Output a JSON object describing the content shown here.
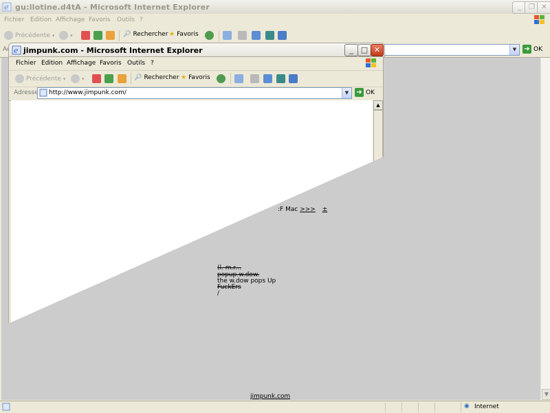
{
  "outer": {
    "title": "gu:llotine.d4tA - Microsoft Internet Explorer",
    "menu": [
      "Fichier",
      "Edition",
      "Affichage",
      "Favoris",
      "Outils",
      "?"
    ],
    "toolbar": {
      "back": "Précédente",
      "search": "Rechercher",
      "favorites": "Favoris"
    },
    "address_label": "Ac",
    "go_label": "OK",
    "status_zone": "Internet"
  },
  "inner": {
    "title": "jimpunk.com - Microsoft Internet Explorer",
    "menu": [
      "Fichier",
      "Edition",
      "Affichage",
      "Favoris",
      "Outils",
      "?"
    ],
    "toolbar": {
      "back": "Précédente",
      "search": "Rechercher",
      "favorites": "Favoris"
    },
    "address_label": "Adresse",
    "address_value": "http://www.jimpunk.com/",
    "go_label": "OK"
  },
  "page": {
    "mac_prefix": ":F Mac",
    "mac_link": ">>>",
    "plus": "±",
    "lines": [
      "(l. m.r...",
      "popup.w.dow.",
      "the w.dow pops Up",
      "FuckErs",
      "/"
    ],
    "footer_link": "jimpunk.com"
  },
  "colors": {
    "gray": "#cccccc",
    "white": "#ffffff",
    "chrome": "#ece9d8"
  }
}
